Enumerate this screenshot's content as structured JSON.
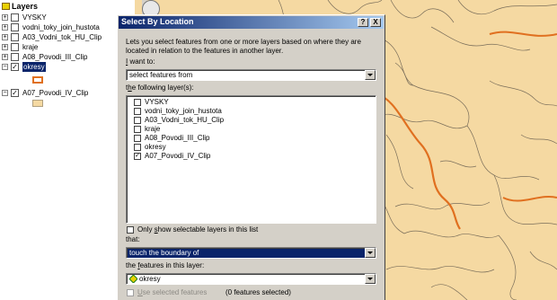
{
  "toc": {
    "header": "Layers",
    "layers": [
      {
        "label": "VYSKY",
        "checked": false,
        "expanded": false
      },
      {
        "label": "vodni_toky_join_hustota",
        "checked": false,
        "expanded": false
      },
      {
        "label": "A03_Vodni_tok_HU_Clip",
        "checked": false,
        "expanded": false
      },
      {
        "label": "kraje",
        "checked": false,
        "expanded": false
      },
      {
        "label": "A08_Povodi_III_Clip",
        "checked": false,
        "expanded": false
      },
      {
        "label": "okresy",
        "checked": true,
        "expanded": true,
        "selected": true,
        "symbol_color": "#e07020"
      },
      {
        "label": "A07_Povodi_IV_Clip",
        "checked": true,
        "expanded": true,
        "symbol_color": "#f5d9a2"
      }
    ],
    "expander_collapsed": "+",
    "expander_expanded": "−",
    "check_mark": "✓"
  },
  "dialog": {
    "title": "Select By Location",
    "help_button": "?",
    "close_button": "X",
    "description": "Lets you select features from one or more layers based on where they are located in relation to the features in another layer.",
    "i_want_to_label_u": "I",
    "i_want_to_label_rest": " want to:",
    "i_want_to_value": "select features from",
    "following_layers_label_pre": "t",
    "following_layers_label_u": "h",
    "following_layers_label_rest": "e following layer(s):",
    "layer_list": [
      {
        "label": "VYSKY",
        "checked": false
      },
      {
        "label": "vodni_toky_join_hustota",
        "checked": false
      },
      {
        "label": "A03_Vodni_tok_HU_Clip",
        "checked": false
      },
      {
        "label": "kraje",
        "checked": false
      },
      {
        "label": "A08_Povodi_III_Clip",
        "checked": false
      },
      {
        "label": "okresy",
        "checked": false
      },
      {
        "label": "A07_Povodi_IV_Clip",
        "checked": true
      }
    ],
    "only_selectable_pre": "Only ",
    "only_selectable_u": "s",
    "only_selectable_rest": "how selectable layers in this list",
    "that_label": "that:",
    "relation_value": "touch the boundary of",
    "features_in_layer_pre": "the ",
    "features_in_layer_u": "f",
    "features_in_layer_rest": "eatures in this layer:",
    "source_layer_value": "okresy",
    "use_selected_u": "U",
    "use_selected_rest": "se selected features",
    "features_selected_status": "(0 features selected)"
  },
  "colors": {
    "map_fill": "#f5d9a2",
    "boundary_line": "#e07020",
    "title_bar": "#0a246a",
    "dialog_face": "#d4d0c8"
  }
}
